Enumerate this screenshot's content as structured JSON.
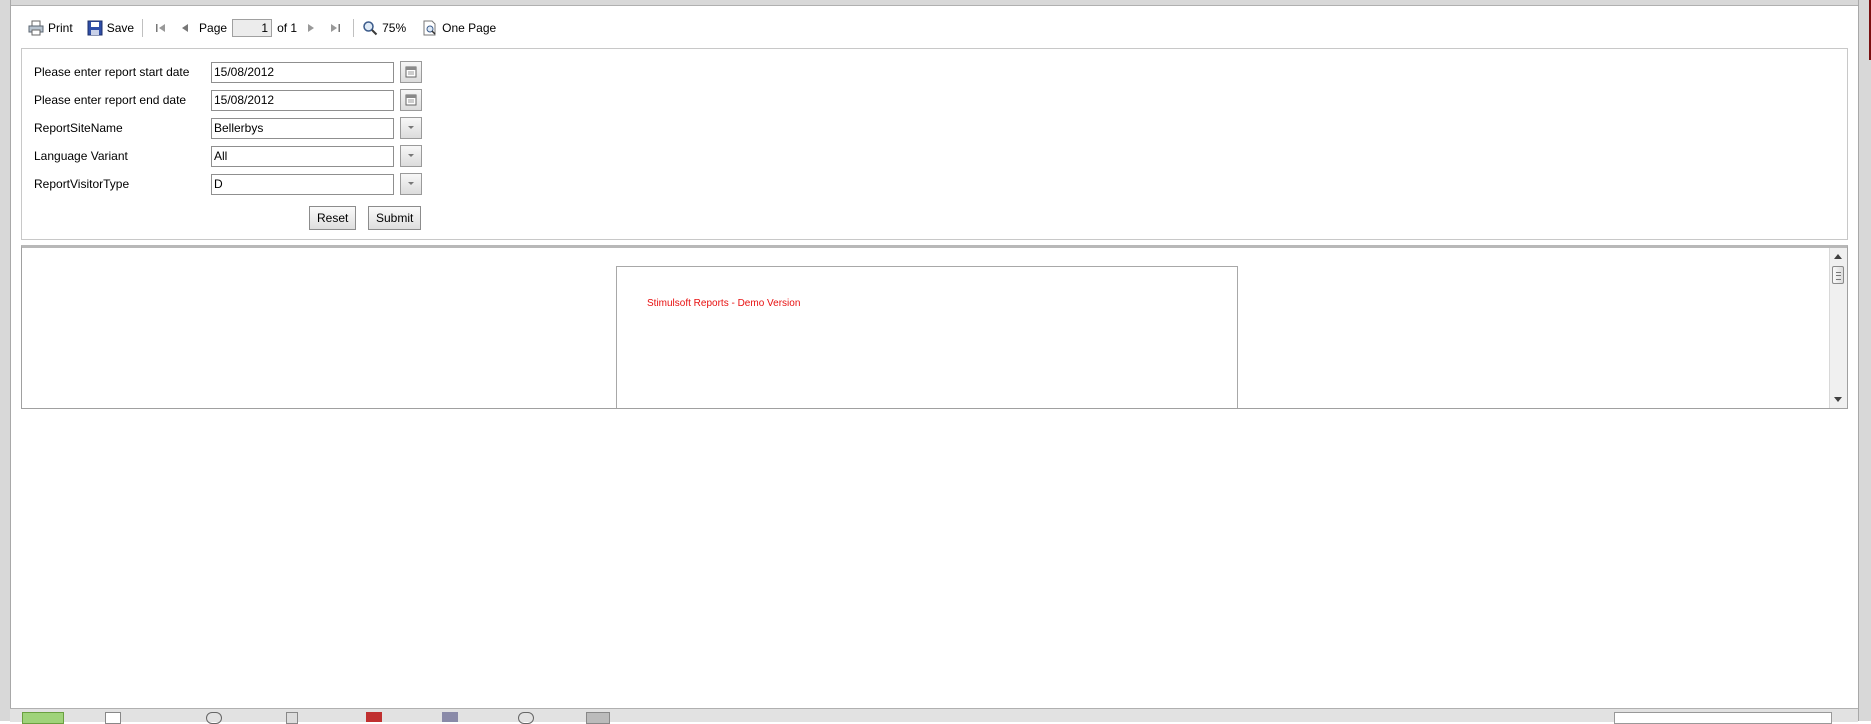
{
  "toolbar": {
    "print_label": "Print",
    "save_label": "Save",
    "page_label": "Page",
    "page_value": "1",
    "page_of": "of 1",
    "zoom_label": "75%",
    "view_mode_label": "One Page"
  },
  "params": [
    {
      "label": "Please enter report start date",
      "value": "15/08/2012",
      "kind": "date"
    },
    {
      "label": "Please enter report end date",
      "value": "15/08/2012",
      "kind": "date"
    },
    {
      "label": "ReportSiteName",
      "value": "Bellerbys",
      "kind": "dropdown"
    },
    {
      "label": "Language Variant",
      "value": "All",
      "kind": "dropdown"
    },
    {
      "label": "ReportVisitorType",
      "value": "D",
      "kind": "dropdown"
    }
  ],
  "buttons": {
    "reset_label": "Reset",
    "submit_label": "Submit"
  },
  "report": {
    "demo_text": "Stimulsoft Reports - Demo Version"
  },
  "colors": {
    "demo_text": "#e81010",
    "frame": "#d8d8d8"
  }
}
